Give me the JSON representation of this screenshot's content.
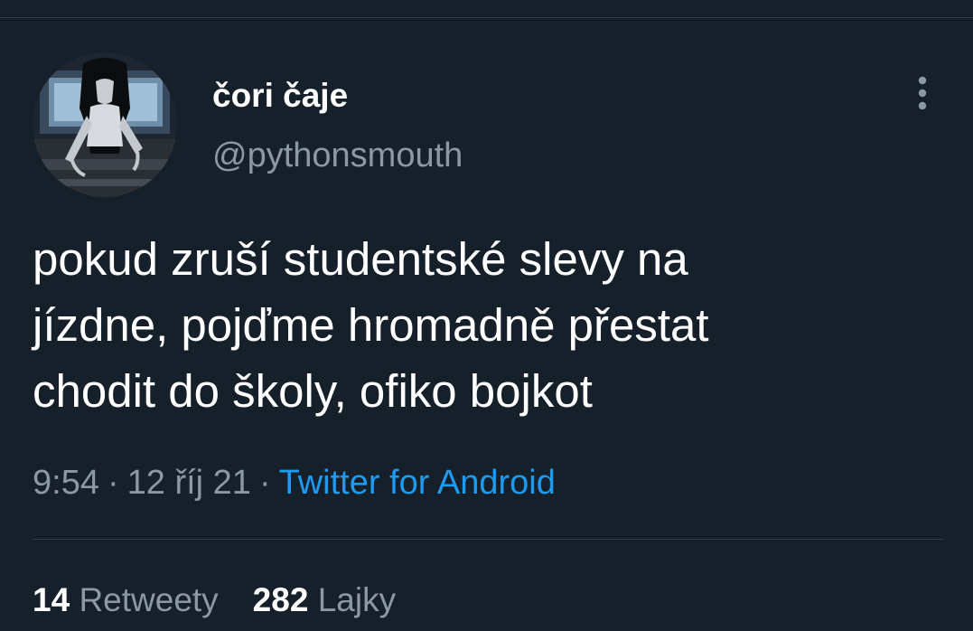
{
  "user": {
    "display_name": "čori čaje",
    "handle": "@pythonsmouth",
    "avatar_icon": "avatar-figure-at-computer"
  },
  "tweet": {
    "lines": [
      "pokud zruší studentské slevy na",
      "jízdne, pojďme hromadně přestat",
      "chodit do školy, ofiko bojkot"
    ]
  },
  "meta": {
    "time": "9:54",
    "separator": "·",
    "date": "12 říj 21",
    "source": "Twitter for Android"
  },
  "stats": {
    "retweets_count": "14",
    "retweets_label": "Retweety",
    "likes_count": "282",
    "likes_label": "Lajky"
  },
  "icons": {
    "more": "more-vertical-icon"
  },
  "colors": {
    "background": "#15202b",
    "text_primary": "#ffffff",
    "text_secondary": "#8b98a5",
    "link": "#1d9bf0",
    "divider": "#2f3a46"
  }
}
